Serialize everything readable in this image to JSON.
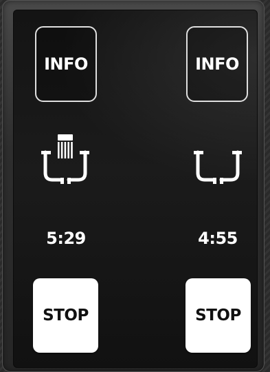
{
  "left_zone": {
    "info_label": "INFO",
    "vessel_icon": "pot-with-brush-icon",
    "timer": "5:29",
    "stop_label": "STOP"
  },
  "right_zone": {
    "info_label": "INFO",
    "vessel_icon": "empty-pot-icon",
    "timer": "4:55",
    "stop_label": "STOP"
  },
  "colors": {
    "screen_background": "#161616",
    "button_border": "#e0e0e0",
    "stop_button_fill": "#ffffff",
    "text": "#ffffff"
  }
}
